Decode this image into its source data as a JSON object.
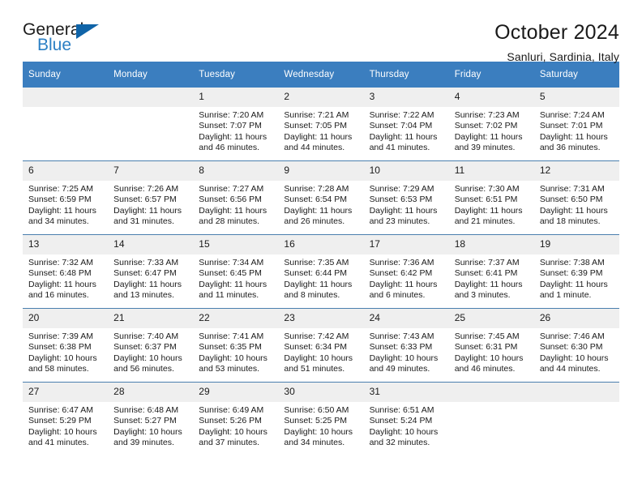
{
  "logo": {
    "word_one": "General",
    "word_two": "Blue",
    "triangle": "blue-triangle-icon"
  },
  "header": {
    "title": "October 2024",
    "subtitle": "Sanluri, Sardinia, Italy"
  },
  "colors": {
    "header_blue": "#3b7ebf",
    "logo_blue": "#2b7fc4",
    "triangle_blue": "#1064a8",
    "daynum_gray": "#efefef",
    "row_rule": "#4a7fae"
  },
  "calendar": {
    "weekday_headers": [
      "Sunday",
      "Monday",
      "Tuesday",
      "Wednesday",
      "Thursday",
      "Friday",
      "Saturday"
    ],
    "weeks": [
      [
        {
          "day": "",
          "sunrise": "",
          "sunset": "",
          "daylight_line1": "",
          "daylight_line2": ""
        },
        {
          "day": "",
          "sunrise": "",
          "sunset": "",
          "daylight_line1": "",
          "daylight_line2": ""
        },
        {
          "day": "1",
          "sunrise": "Sunrise: 7:20 AM",
          "sunset": "Sunset: 7:07 PM",
          "daylight_line1": "Daylight: 11 hours",
          "daylight_line2": "and 46 minutes."
        },
        {
          "day": "2",
          "sunrise": "Sunrise: 7:21 AM",
          "sunset": "Sunset: 7:05 PM",
          "daylight_line1": "Daylight: 11 hours",
          "daylight_line2": "and 44 minutes."
        },
        {
          "day": "3",
          "sunrise": "Sunrise: 7:22 AM",
          "sunset": "Sunset: 7:04 PM",
          "daylight_line1": "Daylight: 11 hours",
          "daylight_line2": "and 41 minutes."
        },
        {
          "day": "4",
          "sunrise": "Sunrise: 7:23 AM",
          "sunset": "Sunset: 7:02 PM",
          "daylight_line1": "Daylight: 11 hours",
          "daylight_line2": "and 39 minutes."
        },
        {
          "day": "5",
          "sunrise": "Sunrise: 7:24 AM",
          "sunset": "Sunset: 7:01 PM",
          "daylight_line1": "Daylight: 11 hours",
          "daylight_line2": "and 36 minutes."
        }
      ],
      [
        {
          "day": "6",
          "sunrise": "Sunrise: 7:25 AM",
          "sunset": "Sunset: 6:59 PM",
          "daylight_line1": "Daylight: 11 hours",
          "daylight_line2": "and 34 minutes."
        },
        {
          "day": "7",
          "sunrise": "Sunrise: 7:26 AM",
          "sunset": "Sunset: 6:57 PM",
          "daylight_line1": "Daylight: 11 hours",
          "daylight_line2": "and 31 minutes."
        },
        {
          "day": "8",
          "sunrise": "Sunrise: 7:27 AM",
          "sunset": "Sunset: 6:56 PM",
          "daylight_line1": "Daylight: 11 hours",
          "daylight_line2": "and 28 minutes."
        },
        {
          "day": "9",
          "sunrise": "Sunrise: 7:28 AM",
          "sunset": "Sunset: 6:54 PM",
          "daylight_line1": "Daylight: 11 hours",
          "daylight_line2": "and 26 minutes."
        },
        {
          "day": "10",
          "sunrise": "Sunrise: 7:29 AM",
          "sunset": "Sunset: 6:53 PM",
          "daylight_line1": "Daylight: 11 hours",
          "daylight_line2": "and 23 minutes."
        },
        {
          "day": "11",
          "sunrise": "Sunrise: 7:30 AM",
          "sunset": "Sunset: 6:51 PM",
          "daylight_line1": "Daylight: 11 hours",
          "daylight_line2": "and 21 minutes."
        },
        {
          "day": "12",
          "sunrise": "Sunrise: 7:31 AM",
          "sunset": "Sunset: 6:50 PM",
          "daylight_line1": "Daylight: 11 hours",
          "daylight_line2": "and 18 minutes."
        }
      ],
      [
        {
          "day": "13",
          "sunrise": "Sunrise: 7:32 AM",
          "sunset": "Sunset: 6:48 PM",
          "daylight_line1": "Daylight: 11 hours",
          "daylight_line2": "and 16 minutes."
        },
        {
          "day": "14",
          "sunrise": "Sunrise: 7:33 AM",
          "sunset": "Sunset: 6:47 PM",
          "daylight_line1": "Daylight: 11 hours",
          "daylight_line2": "and 13 minutes."
        },
        {
          "day": "15",
          "sunrise": "Sunrise: 7:34 AM",
          "sunset": "Sunset: 6:45 PM",
          "daylight_line1": "Daylight: 11 hours",
          "daylight_line2": "and 11 minutes."
        },
        {
          "day": "16",
          "sunrise": "Sunrise: 7:35 AM",
          "sunset": "Sunset: 6:44 PM",
          "daylight_line1": "Daylight: 11 hours",
          "daylight_line2": "and 8 minutes."
        },
        {
          "day": "17",
          "sunrise": "Sunrise: 7:36 AM",
          "sunset": "Sunset: 6:42 PM",
          "daylight_line1": "Daylight: 11 hours",
          "daylight_line2": "and 6 minutes."
        },
        {
          "day": "18",
          "sunrise": "Sunrise: 7:37 AM",
          "sunset": "Sunset: 6:41 PM",
          "daylight_line1": "Daylight: 11 hours",
          "daylight_line2": "and 3 minutes."
        },
        {
          "day": "19",
          "sunrise": "Sunrise: 7:38 AM",
          "sunset": "Sunset: 6:39 PM",
          "daylight_line1": "Daylight: 11 hours",
          "daylight_line2": "and 1 minute."
        }
      ],
      [
        {
          "day": "20",
          "sunrise": "Sunrise: 7:39 AM",
          "sunset": "Sunset: 6:38 PM",
          "daylight_line1": "Daylight: 10 hours",
          "daylight_line2": "and 58 minutes."
        },
        {
          "day": "21",
          "sunrise": "Sunrise: 7:40 AM",
          "sunset": "Sunset: 6:37 PM",
          "daylight_line1": "Daylight: 10 hours",
          "daylight_line2": "and 56 minutes."
        },
        {
          "day": "22",
          "sunrise": "Sunrise: 7:41 AM",
          "sunset": "Sunset: 6:35 PM",
          "daylight_line1": "Daylight: 10 hours",
          "daylight_line2": "and 53 minutes."
        },
        {
          "day": "23",
          "sunrise": "Sunrise: 7:42 AM",
          "sunset": "Sunset: 6:34 PM",
          "daylight_line1": "Daylight: 10 hours",
          "daylight_line2": "and 51 minutes."
        },
        {
          "day": "24",
          "sunrise": "Sunrise: 7:43 AM",
          "sunset": "Sunset: 6:33 PM",
          "daylight_line1": "Daylight: 10 hours",
          "daylight_line2": "and 49 minutes."
        },
        {
          "day": "25",
          "sunrise": "Sunrise: 7:45 AM",
          "sunset": "Sunset: 6:31 PM",
          "daylight_line1": "Daylight: 10 hours",
          "daylight_line2": "and 46 minutes."
        },
        {
          "day": "26",
          "sunrise": "Sunrise: 7:46 AM",
          "sunset": "Sunset: 6:30 PM",
          "daylight_line1": "Daylight: 10 hours",
          "daylight_line2": "and 44 minutes."
        }
      ],
      [
        {
          "day": "27",
          "sunrise": "Sunrise: 6:47 AM",
          "sunset": "Sunset: 5:29 PM",
          "daylight_line1": "Daylight: 10 hours",
          "daylight_line2": "and 41 minutes."
        },
        {
          "day": "28",
          "sunrise": "Sunrise: 6:48 AM",
          "sunset": "Sunset: 5:27 PM",
          "daylight_line1": "Daylight: 10 hours",
          "daylight_line2": "and 39 minutes."
        },
        {
          "day": "29",
          "sunrise": "Sunrise: 6:49 AM",
          "sunset": "Sunset: 5:26 PM",
          "daylight_line1": "Daylight: 10 hours",
          "daylight_line2": "and 37 minutes."
        },
        {
          "day": "30",
          "sunrise": "Sunrise: 6:50 AM",
          "sunset": "Sunset: 5:25 PM",
          "daylight_line1": "Daylight: 10 hours",
          "daylight_line2": "and 34 minutes."
        },
        {
          "day": "31",
          "sunrise": "Sunrise: 6:51 AM",
          "sunset": "Sunset: 5:24 PM",
          "daylight_line1": "Daylight: 10 hours",
          "daylight_line2": "and 32 minutes."
        },
        {
          "day": "",
          "sunrise": "",
          "sunset": "",
          "daylight_line1": "",
          "daylight_line2": ""
        },
        {
          "day": "",
          "sunrise": "",
          "sunset": "",
          "daylight_line1": "",
          "daylight_line2": ""
        }
      ]
    ]
  }
}
